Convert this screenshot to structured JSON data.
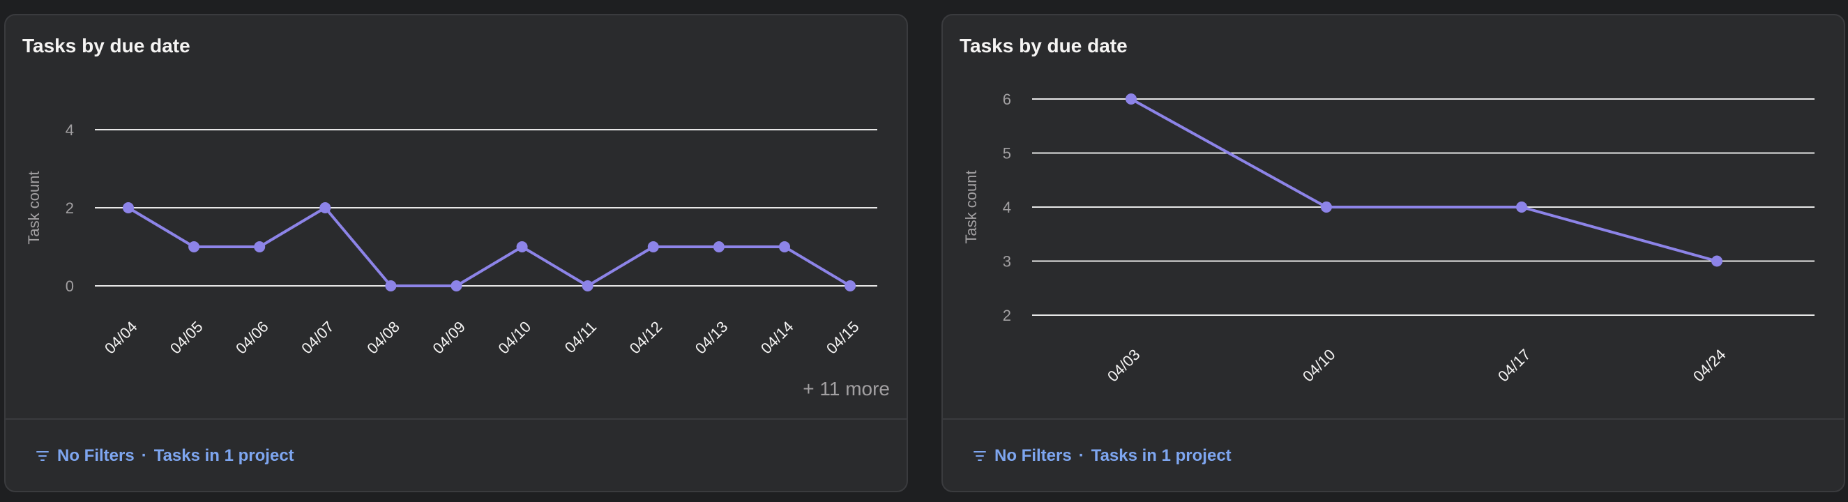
{
  "cards": [
    {
      "title": "Tasks by due date",
      "more_label": "+ 11 more",
      "footer": {
        "filters_label": "No Filters",
        "separator": "·",
        "scope_label": "Tasks in 1 project"
      }
    },
    {
      "title": "Tasks by due date",
      "footer": {
        "filters_label": "No Filters",
        "separator": "·",
        "scope_label": "Tasks in 1 project"
      }
    }
  ],
  "colors": {
    "line": "#8d84e8",
    "grid": "#e8e8e8",
    "text": "#f5f4f3",
    "muted": "#a2a0a2",
    "link": "#7ea6f0"
  },
  "chart_data": [
    {
      "type": "line",
      "ylabel": "Task count",
      "ylim": [
        0,
        4
      ],
      "yticks": [
        0,
        2,
        4
      ],
      "categories": [
        "04/04",
        "04/05",
        "04/06",
        "04/07",
        "04/08",
        "04/09",
        "04/10",
        "04/11",
        "04/12",
        "04/13",
        "04/14",
        "04/15"
      ],
      "series": [
        {
          "values": [
            2,
            1,
            1,
            2,
            0,
            0,
            1,
            0,
            1,
            1,
            1,
            0
          ]
        }
      ],
      "grid": true
    },
    {
      "type": "line",
      "ylabel": "Task count",
      "ylim": [
        2,
        6
      ],
      "yticks": [
        2,
        3,
        4,
        5,
        6
      ],
      "categories": [
        "04/03",
        "04/10",
        "04/17",
        "04/24"
      ],
      "series": [
        {
          "values": [
            6,
            4,
            4,
            3
          ]
        }
      ],
      "grid": true
    }
  ]
}
